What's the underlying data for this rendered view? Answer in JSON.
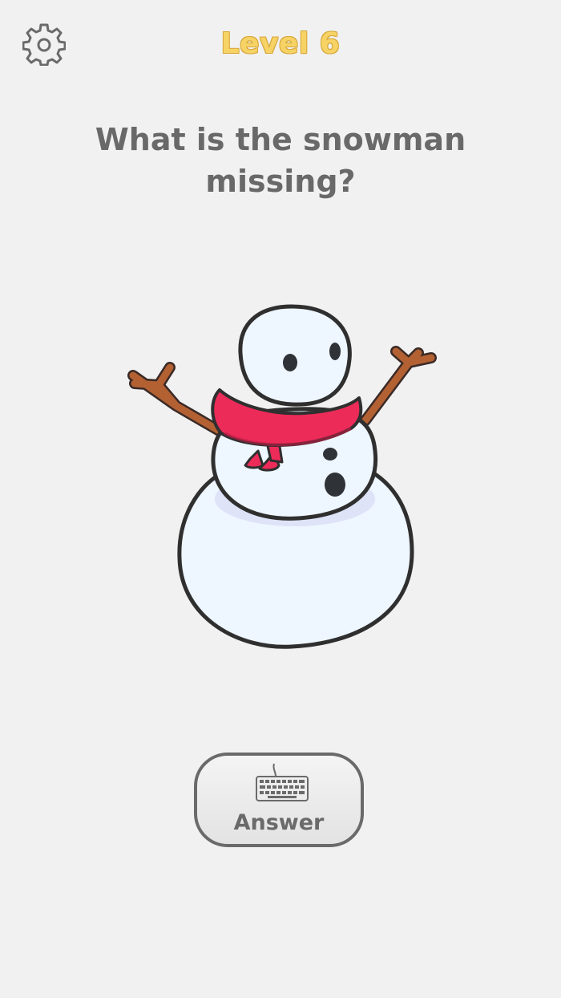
{
  "header": {
    "level_title": "Level 6",
    "settings_icon": "gear-icon"
  },
  "puzzle": {
    "question": "What is the snowman missing?"
  },
  "answer_button": {
    "label": "Answer",
    "icon": "keyboard-icon"
  },
  "colors": {
    "background": "#f1f1f1",
    "level_title": "#f7d366",
    "question_text": "#696969",
    "scarf": "#ec2b59",
    "arms": "#b36133",
    "snow": "#eef6ff"
  }
}
